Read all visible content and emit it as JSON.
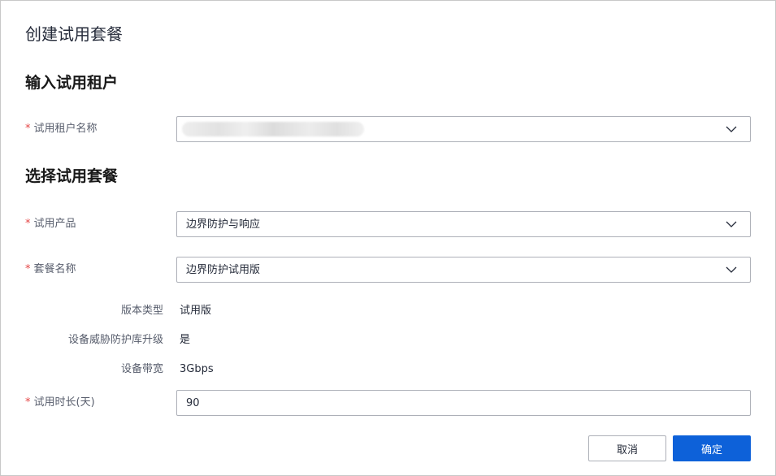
{
  "dialog": {
    "title": "创建试用套餐"
  },
  "tenant_section": {
    "title": "输入试用租户",
    "tenant_name": {
      "label": "试用租户名称",
      "required": "*",
      "value": ""
    }
  },
  "package_section": {
    "title": "选择试用套餐",
    "product": {
      "label": "试用产品",
      "required": "*",
      "value": "边界防护与响应"
    },
    "package_name": {
      "label": "套餐名称",
      "required": "*",
      "value": "边界防护试用版"
    },
    "version_type": {
      "label": "版本类型",
      "value": "试用版"
    },
    "threat_db_upgrade": {
      "label": "设备威胁防护库升级",
      "value": "是"
    },
    "bandwidth": {
      "label": "设备带宽",
      "value": "3Gbps"
    },
    "duration": {
      "label": "试用时长(天)",
      "required": "*",
      "value": "90"
    }
  },
  "buttons": {
    "cancel": "取消",
    "confirm": "确定"
  },
  "icons": {
    "dropdown": "chevron-down-icon"
  },
  "colors": {
    "primary": "#0d61d9",
    "required": "#e54545",
    "border": "#adb0b8"
  }
}
